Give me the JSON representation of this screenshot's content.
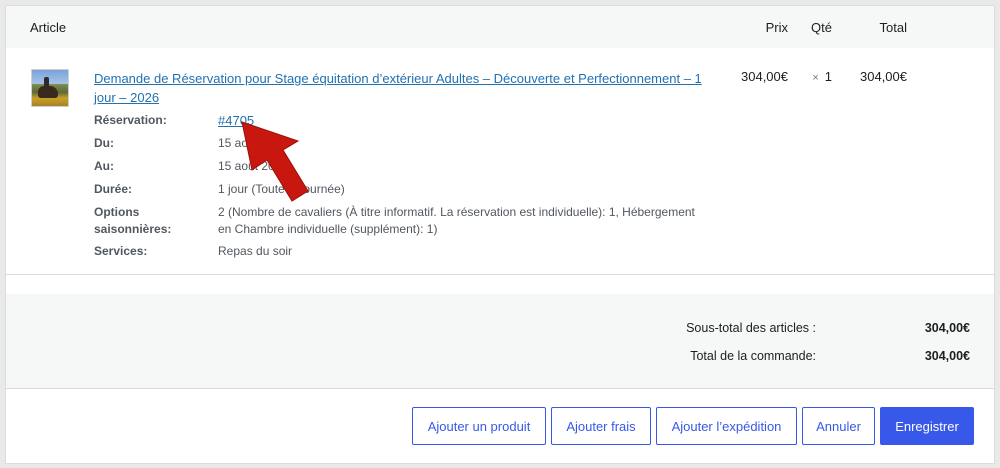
{
  "table_header": {
    "article": "Article",
    "prix": "Prix",
    "qte": "Qté",
    "total": "Total"
  },
  "item": {
    "name": "Demande de Réservation pour Stage équitation d’extérieur Adultes – Découverte et Perfectionnement – 1 jour – 2026",
    "price": "304,00€",
    "qty_symbol": "×",
    "qty": "1",
    "total": "304,00€",
    "meta": [
      {
        "key": "Réservation:",
        "value": "#4705",
        "is_link": true
      },
      {
        "key": "Du:",
        "value": "15 août 2026"
      },
      {
        "key": "Au:",
        "value": "15 août 2026"
      },
      {
        "key": "Durée:",
        "value": "1 jour (Toute la journée)"
      },
      {
        "key": "Options saisonnières:",
        "value": "2 (Nombre de cavaliers (À titre informatif. La réservation est individuelle): 1, Hébergement en Chambre individuelle (supplément): 1)"
      },
      {
        "key": "Services:",
        "value": "Repas du soir"
      }
    ]
  },
  "totals": {
    "subtotal_label": "Sous-total des articles :",
    "subtotal_value": "304,00€",
    "order_total_label": "Total de la commande:",
    "order_total_value": "304,00€"
  },
  "actions": {
    "add_product": "Ajouter un produit",
    "add_fee": "Ajouter frais",
    "add_shipping": "Ajouter l’expédition",
    "cancel": "Annuler",
    "save": "Enregistrer"
  },
  "colors": {
    "accent": "#3858e9",
    "link": "#2271b1",
    "annotation_arrow": "#c8170f"
  }
}
